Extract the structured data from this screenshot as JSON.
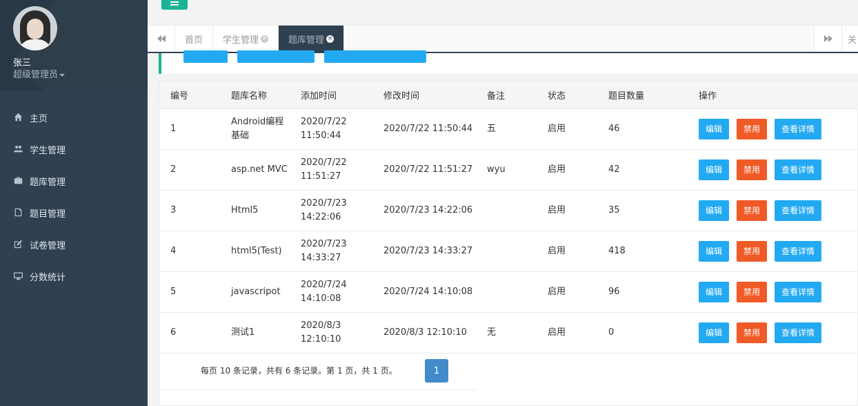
{
  "user": {
    "name": "张三",
    "role": "超级管理员"
  },
  "nav": [
    {
      "label": "主页",
      "icon": "home-icon"
    },
    {
      "label": "学生管理",
      "icon": "users-icon"
    },
    {
      "label": "题库管理",
      "icon": "briefcase-icon"
    },
    {
      "label": "题目管理",
      "icon": "file-icon"
    },
    {
      "label": "试卷管理",
      "icon": "edit-icon"
    },
    {
      "label": "分数统计",
      "icon": "desktop-icon"
    }
  ],
  "tabs": [
    {
      "label": "首页"
    },
    {
      "label": "学生管理"
    },
    {
      "label": "题库管理"
    }
  ],
  "tabs_close_all": "关",
  "colors": {
    "sidebar": "#2f4050",
    "accent": "#1ab394",
    "primary_button": "#23a9f2",
    "danger_button": "#f05a26",
    "pager": "#428bca"
  },
  "table": {
    "headers": [
      "编号",
      "题库名称",
      "添加时间",
      "修改时间",
      "备注",
      "状态",
      "题目数量",
      "操作"
    ],
    "rows": [
      {
        "id": "1",
        "name": "Android编程基础",
        "added": "2020/7/22 11:50:44",
        "modified": "2020/7/22 11:50:44",
        "note": "五",
        "status": "启用",
        "count": "46"
      },
      {
        "id": "2",
        "name": "asp.net MVC",
        "added": "2020/7/22 11:51:27",
        "modified": "2020/7/22 11:51:27",
        "note": "wyu",
        "status": "启用",
        "count": "42"
      },
      {
        "id": "3",
        "name": "Html5",
        "added": "2020/7/23 14:22:06",
        "modified": "2020/7/23 14:22:06",
        "note": "",
        "status": "启用",
        "count": "35"
      },
      {
        "id": "4",
        "name": "html5(Test)",
        "added": "2020/7/23 14:33:27",
        "modified": "2020/7/23 14:33:27",
        "note": "",
        "status": "启用",
        "count": "418"
      },
      {
        "id": "5",
        "name": "javascripot",
        "added": "2020/7/24 14:10:08",
        "modified": "2020/7/24 14:10:08",
        "note": "",
        "status": "启用",
        "count": "96"
      },
      {
        "id": "6",
        "name": "测试1",
        "added": "2020/8/3 12:10:10",
        "modified": "2020/8/3 12:10:10",
        "note": "无",
        "status": "启用",
        "count": "0"
      }
    ],
    "actions": {
      "edit": "编辑",
      "ban": "禁用",
      "detail": "查看详情"
    }
  },
  "pager": {
    "info": "每页 10 条记录，共有 6 条记录。第 1 页，共 1 页。",
    "current": "1"
  }
}
